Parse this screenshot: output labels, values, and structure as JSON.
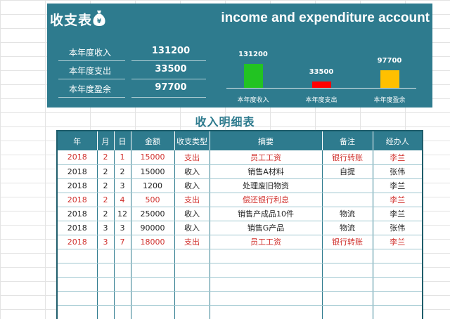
{
  "app": {
    "title": "收支表",
    "subtitle_en": "income and expenditure account"
  },
  "summary": [
    {
      "label": "本年度收入",
      "value": "131200"
    },
    {
      "label": "本年度支出",
      "value": "33500"
    },
    {
      "label": "本年度盈余",
      "value": "97700"
    }
  ],
  "colors": {
    "header_band": "#2e7b8e",
    "income_bar": "#22c322",
    "expense_bar": "#ff0000",
    "surplus_bar": "#ffc000",
    "expense_text": "#d0312d"
  },
  "chart_data": {
    "type": "bar",
    "categories": [
      "本年度收入",
      "本年度支出",
      "本年度盈余"
    ],
    "values": [
      131200,
      33500,
      97700
    ],
    "data_labels": [
      "131200",
      "33500",
      "97700"
    ],
    "bar_colors": [
      "#22c322",
      "#ff0000",
      "#ffc000"
    ],
    "title": "",
    "xlabel": "",
    "ylabel": "",
    "ylim": [
      0,
      131200
    ],
    "grid": false,
    "legend": "none"
  },
  "detail": {
    "title": "收入明细表",
    "columns": [
      "年",
      "月",
      "日",
      "金额",
      "收支类型",
      "摘要",
      "备注",
      "经办人"
    ],
    "rows": [
      {
        "type": "expense",
        "cells": [
          "2018",
          "2",
          "1",
          "15000",
          "支出",
          "员工工资",
          "银行转账",
          "李兰"
        ]
      },
      {
        "type": "income",
        "cells": [
          "2018",
          "2",
          "2",
          "15000",
          "收入",
          "销售A材料",
          "自提",
          "张伟"
        ]
      },
      {
        "type": "income",
        "cells": [
          "2018",
          "2",
          "3",
          "1200",
          "收入",
          "处理废旧物资",
          "",
          "李兰"
        ]
      },
      {
        "type": "expense",
        "cells": [
          "2018",
          "2",
          "4",
          "500",
          "支出",
          "偿还银行利息",
          "",
          "李兰"
        ]
      },
      {
        "type": "income",
        "cells": [
          "2018",
          "2",
          "12",
          "25000",
          "收入",
          "销售产成品10件",
          "物流",
          "李兰"
        ]
      },
      {
        "type": "income",
        "cells": [
          "2018",
          "3",
          "3",
          "90000",
          "收入",
          "销售G产品",
          "物流",
          "张伟"
        ]
      },
      {
        "type": "expense",
        "cells": [
          "2018",
          "3",
          "7",
          "18000",
          "支出",
          "员工工资",
          "银行转账",
          "李兰"
        ]
      }
    ],
    "empty_rows": 6
  }
}
